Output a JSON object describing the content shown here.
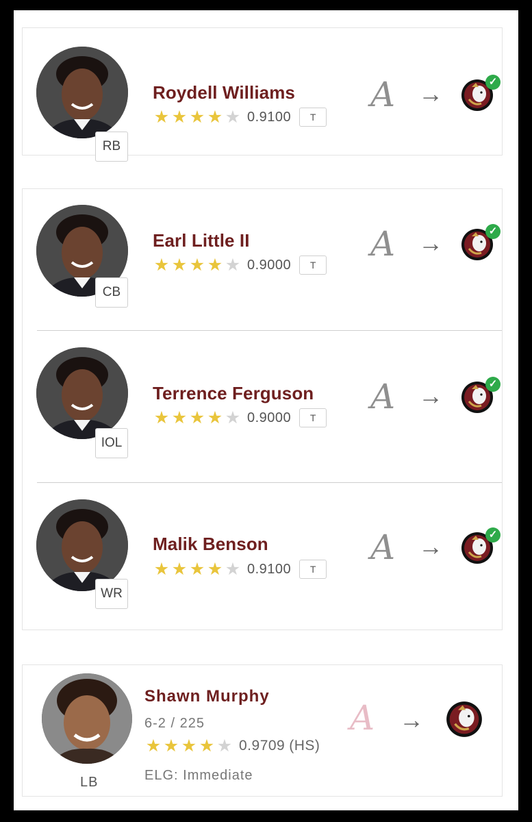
{
  "players": [
    {
      "name": "Roydell Williams",
      "position": "RB",
      "stars_filled": 4,
      "stars_total": 5,
      "rating": "0.9100",
      "badge": "T",
      "from_school_icon": "alabama-script-a-icon",
      "to_school_icon": "fsu-seminole-head-icon",
      "committed": true
    },
    {
      "name": "Earl Little II",
      "position": "CB",
      "stars_filled": 4,
      "stars_total": 5,
      "rating": "0.9000",
      "badge": "T",
      "from_school_icon": "alabama-script-a-icon",
      "to_school_icon": "fsu-seminole-head-icon",
      "committed": true
    },
    {
      "name": "Terrence Ferguson",
      "position": "IOL",
      "stars_filled": 4,
      "stars_total": 5,
      "rating": "0.9000",
      "badge": "T",
      "from_school_icon": "alabama-script-a-icon",
      "to_school_icon": "fsu-seminole-head-icon",
      "committed": true
    },
    {
      "name": "Malik Benson",
      "position": "WR",
      "stars_filled": 4,
      "stars_total": 5,
      "rating": "0.9100",
      "badge": "T",
      "from_school_icon": "alabama-script-a-icon",
      "to_school_icon": "fsu-seminole-head-icon",
      "committed": true
    }
  ],
  "featured": {
    "name": "Shawn Murphy",
    "position": "LB",
    "measurements": "6-2 / 225",
    "stars_filled": 4,
    "stars_total": 5,
    "rating": "0.9709",
    "rating_suffix": "(HS)",
    "eligibility": "ELG: Immediate",
    "from_school_icon": "alabama-script-a-icon",
    "to_school_icon": "fsu-seminole-head-icon"
  },
  "icons": {
    "arrow": "→",
    "check": "✓",
    "star": "★",
    "alabama_letter": "A"
  },
  "colors": {
    "name": "#6e1f1f",
    "star_filled": "#e9c53c",
    "star_empty": "#d3d3d3",
    "check": "#2eaa4a",
    "alabama_faded": "#e8bcc6",
    "alabama_gray": "#8f8f8f",
    "fsu_garnet": "#7a1c22",
    "fsu_gold": "#cfa64a"
  }
}
